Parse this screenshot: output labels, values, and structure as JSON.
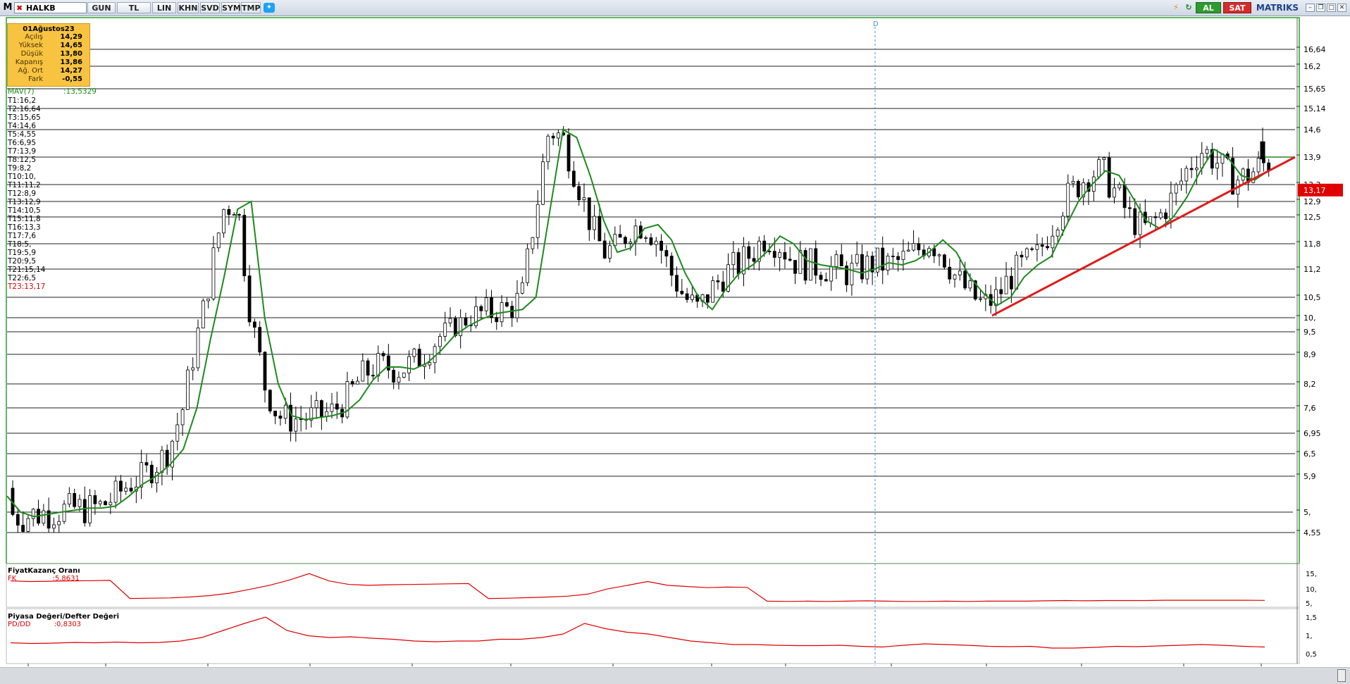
{
  "toolbar": {
    "menu_letter": "M",
    "symbol": "HALKB",
    "buttons": [
      "GUN",
      "TL",
      "LIN",
      "KHN",
      "SVD",
      "SYM",
      "TMP"
    ],
    "buy_label": "AL",
    "sell_label": "SAT",
    "brand": "MATRIKS",
    "icons": [
      "lightning-icon",
      "refresh-icon",
      "twitter-icon"
    ]
  },
  "infobox": {
    "date": "01Ağustos23",
    "rows": [
      {
        "label": "Açılış",
        "value": "14,29"
      },
      {
        "label": "Yüksek",
        "value": "14,65"
      },
      {
        "label": "Düşük",
        "value": "13,80"
      },
      {
        "label": "Kapanış",
        "value": "13,86"
      },
      {
        "label": "Ağ. Ort",
        "value": "14,27"
      },
      {
        "label": "Fark",
        "value": "-0,55"
      }
    ]
  },
  "mav_label": "MAV(7)",
  "mav_value": ":13,5329",
  "levels": [
    "T1:16,2",
    "T2:16,64",
    "T3:15,65",
    "T4:14,6",
    "T5:4,55",
    "T6:6,95",
    "T7:13,9",
    "T8:12,5",
    "T9:8,2",
    "T10:10,",
    "T11:11,2",
    "T12:8,9",
    "T13:12,9",
    "T14:10,5",
    "T15:11,8",
    "T16:13,3",
    "T17:7,6",
    "T18:5,",
    "T19:5,9",
    "T20:9,5",
    "T21:15,14",
    "T22:6,5",
    "T23:13,17"
  ],
  "marker_label": "D",
  "price_axis": [
    "16,64",
    "16,2",
    "15,65",
    "15,14",
    "14,6",
    "13,9",
    "13,3",
    "12,9",
    "12,5",
    "11,8",
    "11,2",
    "10,5",
    "10,",
    "9,5",
    "8,9",
    "8,2",
    "7,6",
    "6,95",
    "6,5",
    "5,9",
    "5,",
    "4,55"
  ],
  "current_price": "13,17",
  "colors": {
    "ma": "#1e8a1e",
    "trend": "#e01b1b",
    "indicator": "#e00000",
    "current": "#e00000",
    "frame": "#2ea02e"
  },
  "panels": [
    {
      "title": "FiyatKazanç Oranı",
      "series": "FK",
      "value": ":5,8631",
      "axis": [
        "15,",
        "10,",
        "5,"
      ]
    },
    {
      "title": "Piyasa Değeri/Defter Değeri",
      "series": "PD/DD",
      "value": ":0,8303",
      "axis": [
        "1,5",
        "1,",
        "0,5"
      ]
    }
  ],
  "chart_data": {
    "type": "candlestick",
    "series": [
      {
        "name": "MAV(7)",
        "last": 13.5329
      },
      {
        "name": "FK",
        "last": 5.8631
      },
      {
        "name": "PD/DD",
        "last": 0.8303
      }
    ],
    "ylim": [
      4.55,
      16.64
    ],
    "horizontal_levels": [
      16.64,
      16.2,
      15.65,
      15.14,
      14.6,
      13.9,
      13.3,
      12.9,
      12.5,
      11.8,
      11.2,
      10.5,
      10.0,
      9.5,
      8.9,
      8.2,
      7.6,
      6.95,
      6.5,
      5.9,
      5.0,
      4.55
    ],
    "last_candle": {
      "open": 14.29,
      "high": 14.65,
      "low": 13.8,
      "close": 13.86
    },
    "trendline": {
      "from_price": 10.05,
      "to_price": 13.9
    },
    "ma_shape": [
      5.4,
      5.0,
      4.9,
      4.95,
      5.0,
      5.05,
      5.1,
      5.1,
      5.15,
      5.4,
      5.7,
      5.9,
      6.2,
      6.6,
      7.6,
      9.3,
      11.0,
      12.7,
      12.9,
      10.0,
      8.2,
      7.4,
      7.3,
      7.35,
      7.4,
      7.5,
      7.8,
      8.3,
      8.6,
      8.6,
      8.55,
      8.7,
      9.0,
      9.4,
      9.7,
      9.95,
      10.1,
      10.15,
      10.2,
      10.5,
      12.6,
      14.6,
      14.4,
      13.5,
      12.4,
      11.6,
      11.7,
      12.2,
      12.3,
      11.9,
      11.1,
      10.5,
      10.2,
      10.7,
      11.1,
      11.3,
      11.6,
      12.0,
      11.8,
      11.4,
      11.3,
      11.25,
      11.2,
      11.1,
      11.2,
      11.35,
      11.3,
      11.4,
      11.6,
      11.9,
      11.6,
      11.0,
      10.6,
      10.3,
      10.5,
      11.0,
      11.3,
      11.5,
      12.2,
      12.9,
      13.3,
      13.6,
      13.5,
      13.0,
      12.4,
      12.2,
      12.5,
      13.0,
      13.6,
      14.1,
      13.9,
      13.5,
      13.4,
      13.6
    ],
    "fk_shape": [
      12.5,
      12.3,
      12.4,
      12.5,
      12.6,
      12.7,
      6.5,
      6.6,
      6.7,
      7.0,
      7.5,
      8.3,
      9.6,
      11.0,
      12.8,
      15.0,
      12.5,
      11.3,
      11.0,
      11.2,
      11.3,
      11.4,
      11.5,
      11.6,
      6.5,
      6.6,
      6.8,
      7.0,
      7.3,
      8.0,
      9.8,
      11.0,
      12.3,
      11.0,
      10.6,
      10.2,
      10.4,
      10.3,
      5.6,
      5.5,
      5.6,
      5.5,
      5.6,
      5.7,
      5.6,
      5.5,
      5.5,
      5.6,
      5.5,
      5.6,
      5.6,
      5.6,
      5.7,
      5.8,
      5.7,
      5.8,
      5.8,
      5.8,
      5.9,
      5.9,
      5.9,
      5.9,
      5.9,
      5.86
    ],
    "pddd_shape": [
      0.95,
      0.93,
      0.94,
      0.96,
      0.95,
      0.97,
      0.95,
      0.96,
      1.0,
      1.1,
      1.3,
      1.5,
      1.68,
      1.3,
      1.15,
      1.1,
      1.12,
      1.08,
      1.05,
      1.0,
      0.98,
      1.0,
      1.0,
      1.05,
      1.05,
      1.1,
      1.2,
      1.5,
      1.35,
      1.25,
      1.2,
      1.1,
      1.0,
      0.95,
      0.9,
      0.9,
      0.88,
      0.87,
      0.87,
      0.88,
      0.85,
      0.83,
      0.88,
      0.92,
      0.9,
      0.88,
      0.85,
      0.84,
      0.85,
      0.8,
      0.8,
      0.82,
      0.85,
      0.84,
      0.86,
      0.88,
      0.9,
      0.88,
      0.85,
      0.83
    ]
  },
  "date_axis": [
    "…",
    "…",
    "…",
    "…",
    "…",
    "…",
    "…",
    "…",
    "…",
    "…",
    "…",
    "…",
    "…"
  ]
}
